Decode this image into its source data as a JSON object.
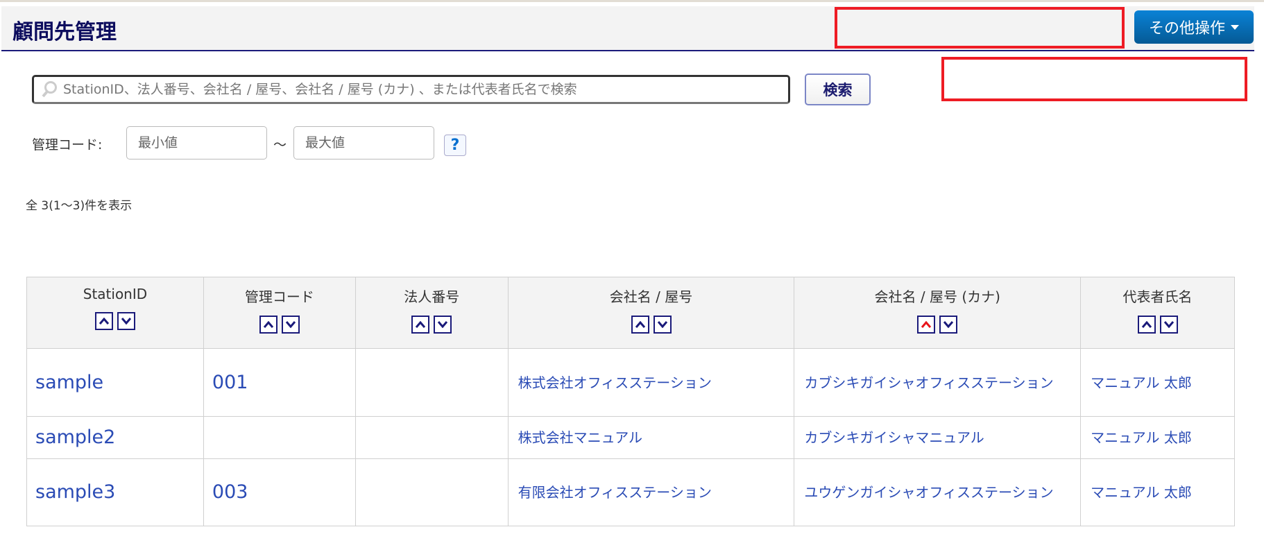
{
  "header": {
    "title": "顧問先管理",
    "other_ops": "その他操作"
  },
  "search": {
    "placeholder": "StationID、法人番号、会社名 / 屋号、会社名 / 屋号 (カナ) 、または代表者氏名で検索",
    "button": "検索"
  },
  "code_filter": {
    "label": "管理コード:",
    "min_placeholder": "最小値",
    "max_placeholder": "最大値",
    "tilde": "～",
    "help": "?"
  },
  "count_text": "全 3(1～3)件を表示",
  "table": {
    "columns": [
      "StationID",
      "管理コード",
      "法人番号",
      "会社名 / 屋号",
      "会社名 / 屋号 (カナ)",
      "代表者氏名"
    ],
    "active_sort": {
      "column": "会社名 / 屋号 (カナ)",
      "direction": "asc",
      "color": "#e8151b"
    },
    "rows": [
      {
        "station_id": "sample",
        "code": "001",
        "corp_no": "",
        "name": "株式会社オフィスステーション",
        "kana": "カブシキガイシャオフィスステーション",
        "rep": "マニュアル 太郎"
      },
      {
        "station_id": "sample2",
        "code": "",
        "corp_no": "",
        "name": "株式会社マニュアル",
        "kana": "カブシキガイシャマニュアル",
        "rep": "マニュアル 太郎"
      },
      {
        "station_id": "sample3",
        "code": "003",
        "corp_no": "",
        "name": "有限会社オフィスステーション",
        "kana": "ユウゲンガイシャオフィスステーション",
        "rep": "マニュアル 太郎"
      }
    ]
  }
}
